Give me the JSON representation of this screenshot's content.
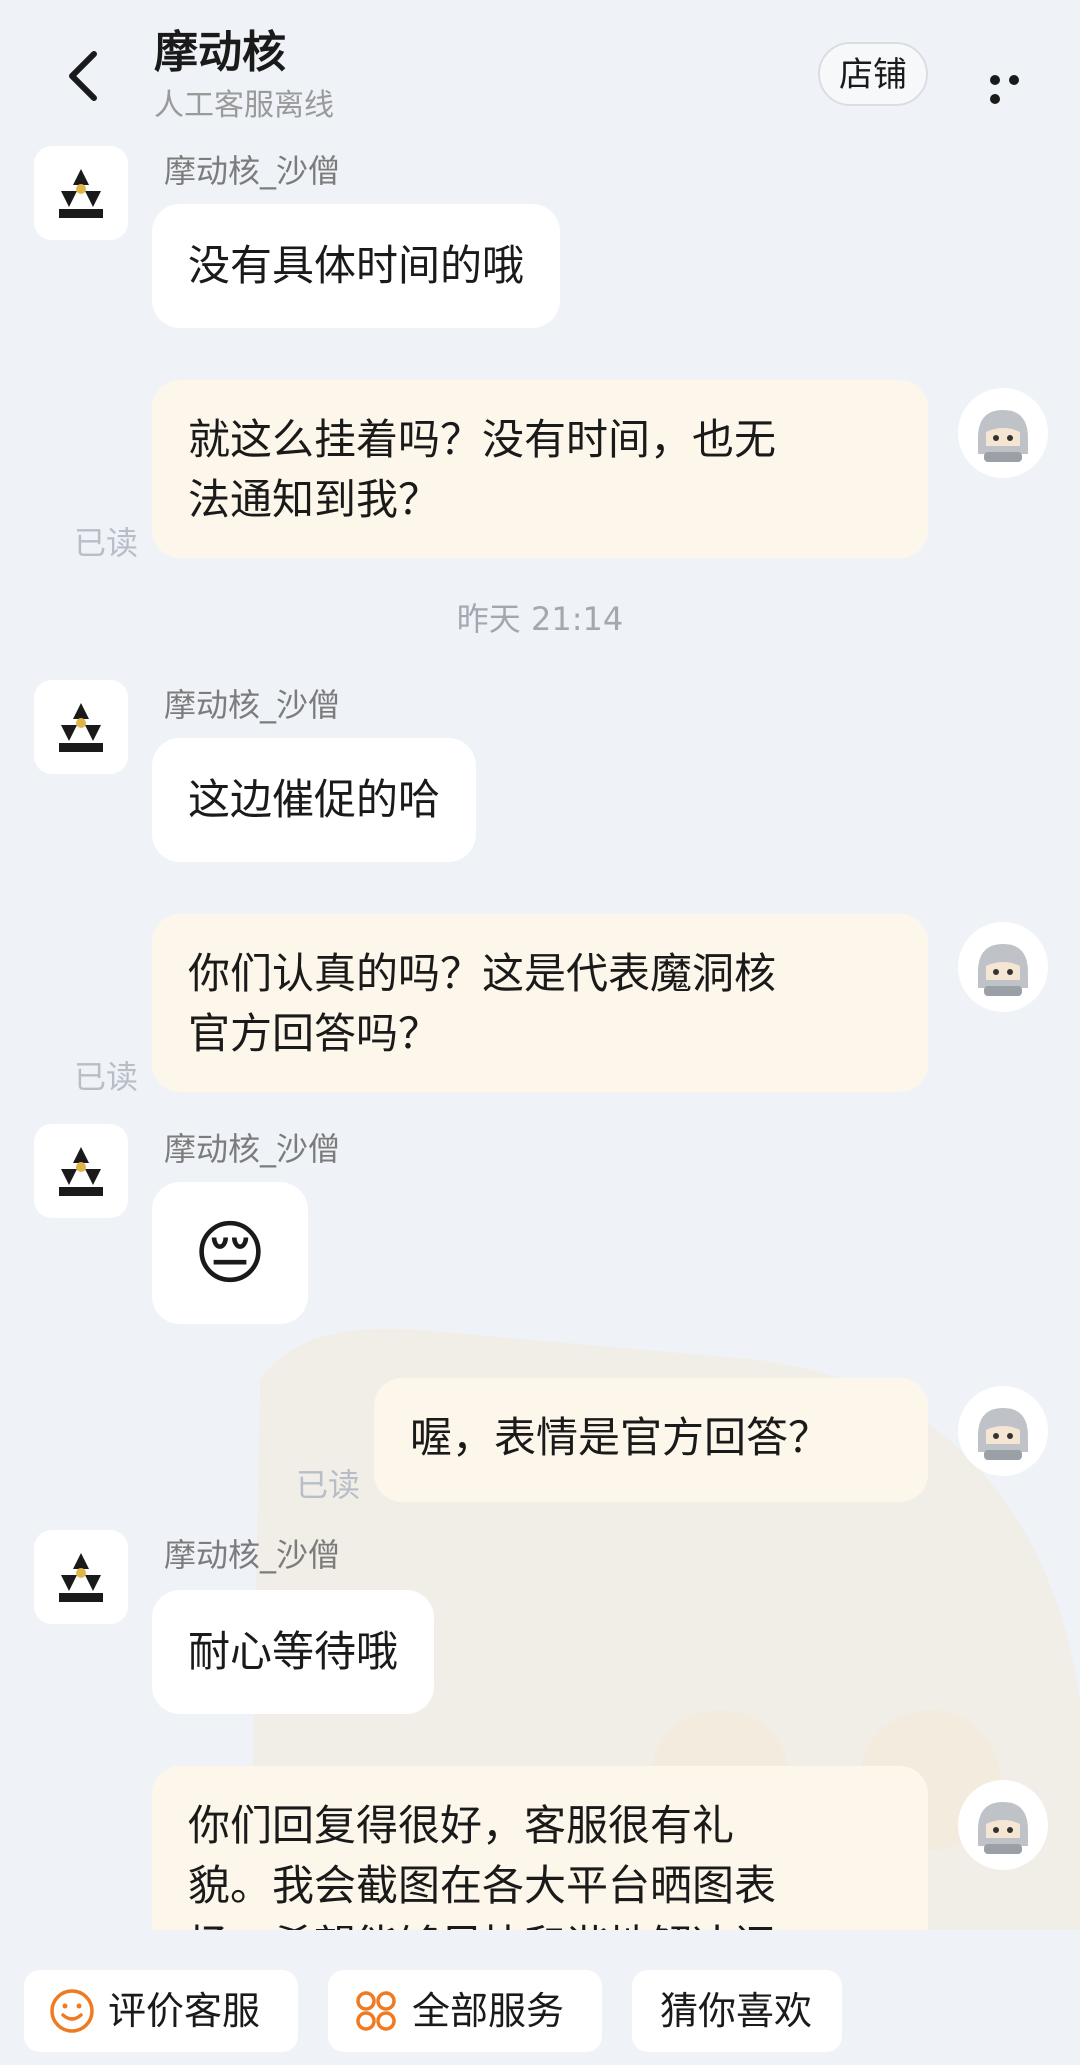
{
  "header": {
    "title": "摩动核",
    "subtitle": "人工客服离线",
    "shop_label": "店铺"
  },
  "messages": [
    {
      "sender": "摩动核_沙僧",
      "text": "没有具体时间的哦"
    },
    {
      "text_line1": "就这么挂着吗？没有时间，也无",
      "text_line2": "法通知到我？",
      "read": "已读"
    },
    {
      "sender": "摩动核_沙僧",
      "text": "这边催促的哈"
    },
    {
      "text_line1": "你们认真的吗？这是代表魔洞核",
      "text_line2": "官方回答吗？",
      "read": "已读"
    },
    {
      "sender": "摩动核_沙僧",
      "emoji": "😔"
    },
    {
      "text": "喔，表情是官方回答？",
      "read": "已读"
    },
    {
      "sender": "摩动核_沙僧",
      "text": "耐心等待哦"
    },
    {
      "text_line1": "你们回复得很好，客服很有礼",
      "text_line2": "貌。我会截图在各大平台晒图表",
      "text_line3": "扬，希望能够尽快和谐地解决问"
    }
  ],
  "timestamp": "昨天  21:14",
  "bottom_bar": {
    "rate_label": "评价客服",
    "services_label": "全部服务",
    "guess_label": "猜你喜欢"
  },
  "colors": {
    "background": "#eff3f8",
    "incoming_bubble": "#ffffff",
    "outgoing_bubble": "#fdf6ea",
    "accent": "#f07a22"
  }
}
